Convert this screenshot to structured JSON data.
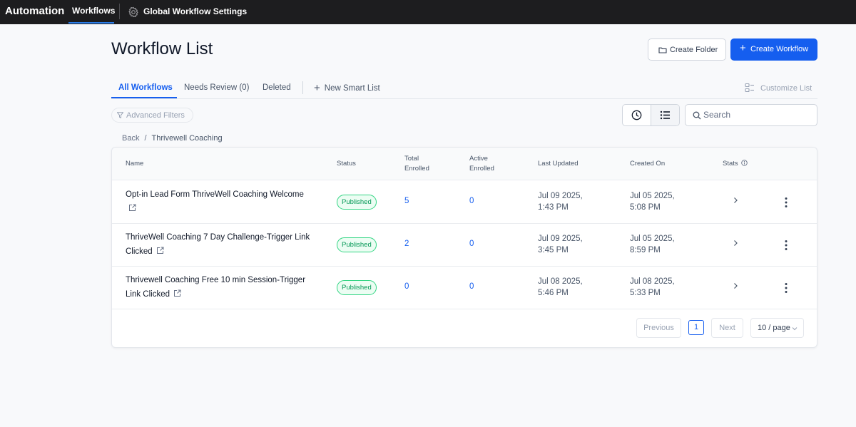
{
  "header": {
    "app_title": "Automation",
    "nav_workflows": "Workflows",
    "nav_settings": "Global Workflow Settings"
  },
  "page": {
    "title": "Workflow List",
    "create_folder": "Create Folder",
    "create_workflow": "Create Workflow"
  },
  "tabs": {
    "all": "All Workflows",
    "needs_review": "Needs Review (0)",
    "deleted": "Deleted",
    "new_smart_list": "New Smart List",
    "customize": "Customize List"
  },
  "filters": {
    "advanced": "Advanced Filters",
    "search_placeholder": "Search"
  },
  "breadcrumb": {
    "back": "Back",
    "separator": "/",
    "current": "Thrivewell Coaching"
  },
  "table": {
    "headers": {
      "name": "Name",
      "status": "Status",
      "total_enrolled_1": "Total",
      "total_enrolled_2": "Enrolled",
      "active_enrolled_1": "Active",
      "active_enrolled_2": "Enrolled",
      "last_updated": "Last Updated",
      "created_on": "Created On",
      "stats": "Stats"
    },
    "rows": [
      {
        "name": "Opt-in Lead Form ThriveWell Coaching Welcome",
        "status": "Published",
        "total_enrolled": "5",
        "active_enrolled": "0",
        "updated_date": "Jul 09 2025,",
        "updated_time": "1:43 PM",
        "created_date": "Jul 05 2025,",
        "created_time": "5:08 PM"
      },
      {
        "name": "ThriveWell Coaching 7 Day Challenge-Trigger Link Clicked",
        "status": "Published",
        "total_enrolled": "2",
        "active_enrolled": "0",
        "updated_date": "Jul 09 2025,",
        "updated_time": "3:45 PM",
        "created_date": "Jul 05 2025,",
        "created_time": "8:59 PM"
      },
      {
        "name": "Thrivewell Coaching Free 10 min Session-Trigger Link Clicked",
        "status": "Published",
        "total_enrolled": "0",
        "active_enrolled": "0",
        "updated_date": "Jul 08 2025,",
        "updated_time": "5:46 PM",
        "created_date": "Jul 08 2025,",
        "created_time": "5:33 PM"
      }
    ]
  },
  "pagination": {
    "previous": "Previous",
    "page": "1",
    "next": "Next",
    "page_size": "10 / page"
  },
  "colors": {
    "primary": "#155eef",
    "topbar": "#1d1d1f",
    "published_text": "#039855",
    "published_border": "#32d583"
  },
  "icons": {
    "settings": "gear-icon",
    "folder": "folder-icon",
    "plus": "plus-icon",
    "customize": "layout-icon",
    "filter": "filter-icon",
    "history": "clock-icon",
    "list": "list-icon",
    "search": "search-icon",
    "external": "external-link-icon",
    "row_chevron": "chevron-right-icon",
    "row_menu": "kebab-icon",
    "info": "info-icon"
  }
}
